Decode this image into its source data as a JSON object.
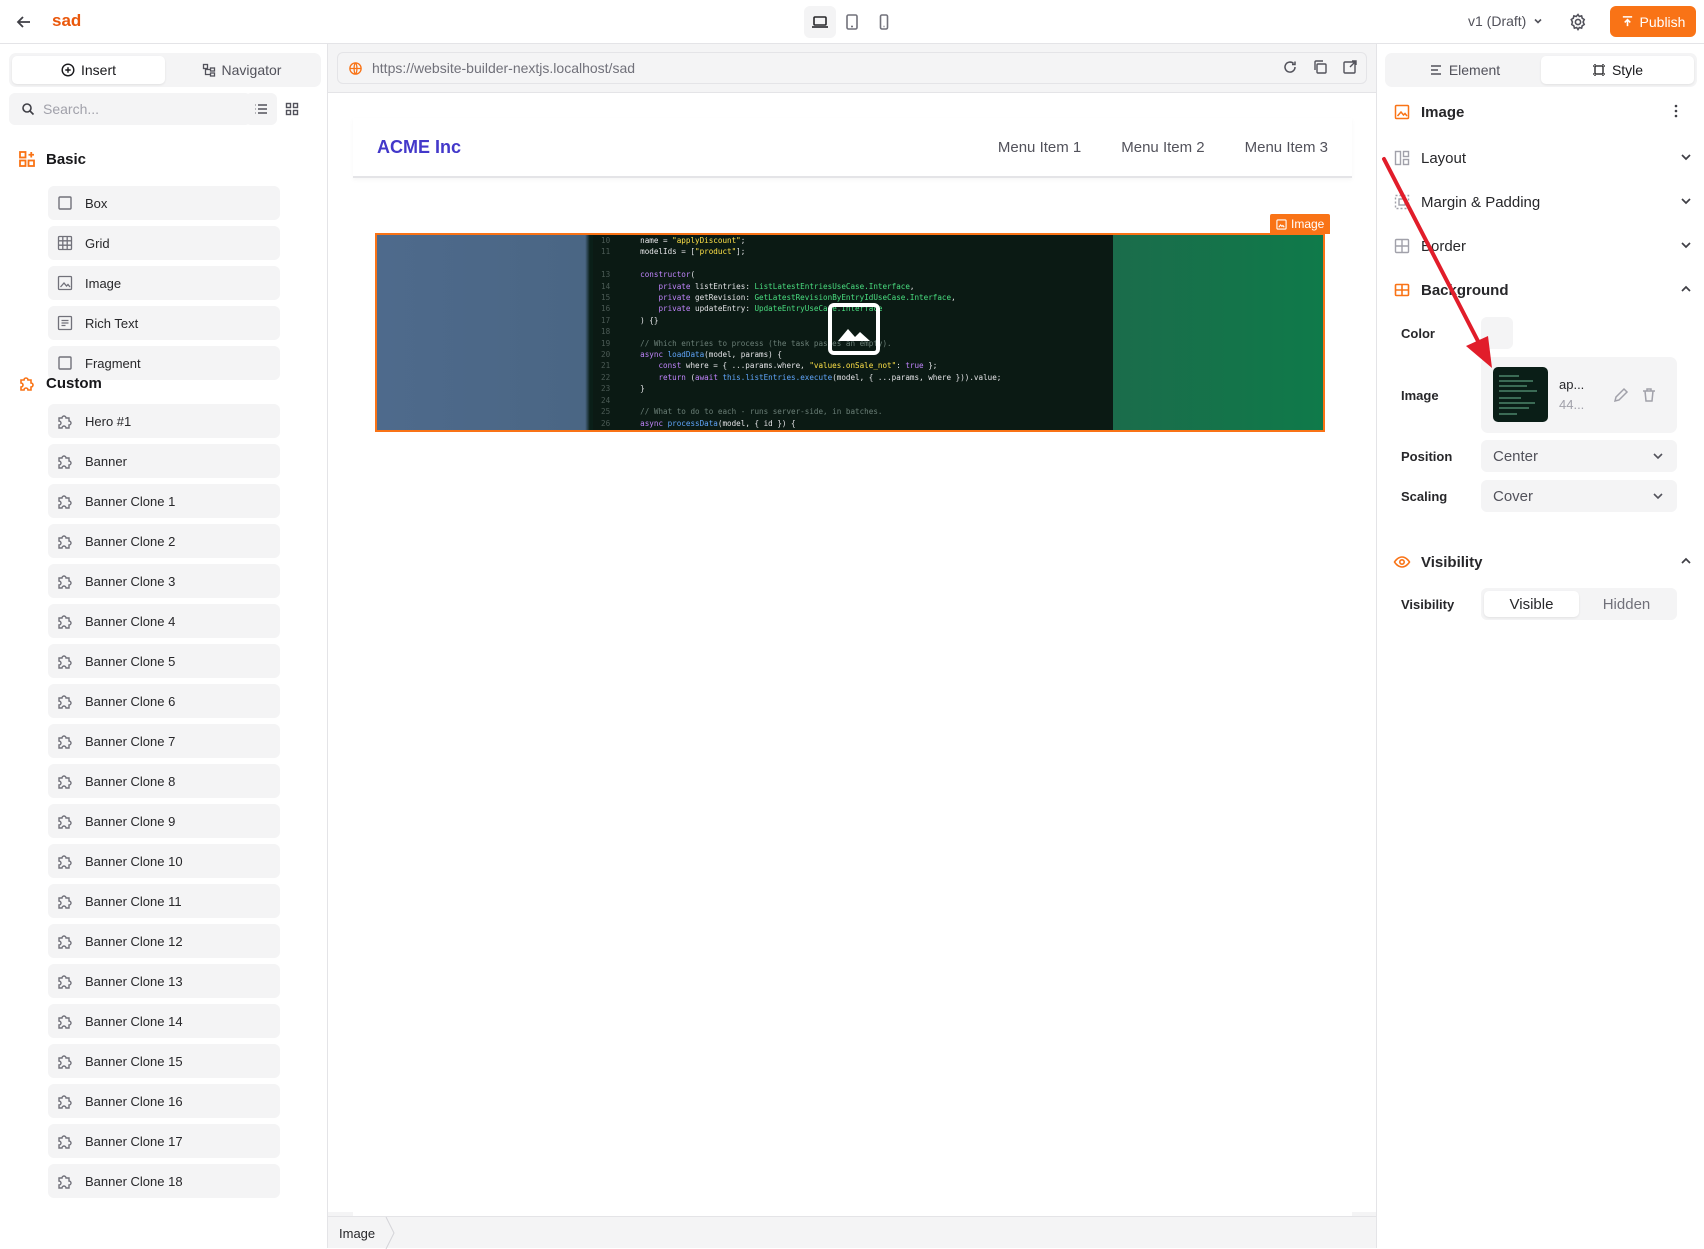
{
  "topbar": {
    "site_name": "sad",
    "version_label": "v1 (Draft)",
    "publish_label": "Publish",
    "accent": "#f97316"
  },
  "left": {
    "tabs": [
      {
        "label": "Insert"
      },
      {
        "label": "Navigator"
      }
    ],
    "search_placeholder": "Search...",
    "basic_title": "Basic",
    "basic_items": [
      {
        "label": "Box"
      },
      {
        "label": "Grid"
      },
      {
        "label": "Image"
      },
      {
        "label": "Rich Text"
      },
      {
        "label": "Fragment"
      }
    ],
    "custom_title": "Custom",
    "custom_items": [
      {
        "label": "Hero #1"
      },
      {
        "label": "Banner"
      },
      {
        "label": "Banner Clone 1"
      },
      {
        "label": "Banner Clone 2"
      },
      {
        "label": "Banner Clone 3"
      },
      {
        "label": "Banner Clone 4"
      },
      {
        "label": "Banner Clone 5"
      },
      {
        "label": "Banner Clone 6"
      },
      {
        "label": "Banner Clone 7"
      },
      {
        "label": "Banner Clone 8"
      },
      {
        "label": "Banner Clone 9"
      },
      {
        "label": "Banner Clone 10"
      },
      {
        "label": "Banner Clone 11"
      },
      {
        "label": "Banner Clone 12"
      },
      {
        "label": "Banner Clone 13"
      },
      {
        "label": "Banner Clone 14"
      },
      {
        "label": "Banner Clone 15"
      },
      {
        "label": "Banner Clone 16"
      },
      {
        "label": "Banner Clone 17"
      },
      {
        "label": "Banner Clone 18"
      }
    ]
  },
  "canvas": {
    "url": "https://website-builder-nextjs.localhost/sad",
    "brand": "ACME Inc",
    "menu": [
      {
        "label": "Menu Item 1"
      },
      {
        "label": "Menu Item 2"
      },
      {
        "label": "Menu Item 3"
      }
    ],
    "selected_tag": "Image",
    "breadcrumb": "Image"
  },
  "right": {
    "tabs": [
      {
        "label": "Element"
      },
      {
        "label": "Style"
      }
    ],
    "element_title": "Image",
    "sections": {
      "layout": "Layout",
      "margin_padding": "Margin & Padding",
      "border": "Border",
      "background": "Background",
      "visibility": "Visibility"
    },
    "background": {
      "color_label": "Color",
      "image_label": "Image",
      "image_name": "ap...",
      "image_size": "44...",
      "position_label": "Position",
      "position_value": "Center",
      "scaling_label": "Scaling",
      "scaling_value": "Cover"
    },
    "visibility": {
      "label": "Visibility",
      "options": [
        {
          "label": "Visible"
        },
        {
          "label": "Hidden"
        }
      ],
      "selected": "Visible"
    }
  }
}
